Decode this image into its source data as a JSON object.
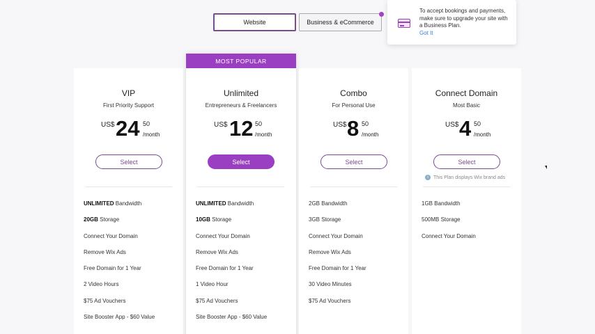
{
  "tabs": [
    {
      "label": "Website",
      "active": true
    },
    {
      "label": "Business & eCommerce",
      "active": false
    }
  ],
  "tooltip": {
    "message": "To accept bookings and payments, make sure to upgrade your site with a Business Plan.",
    "action": "Got It"
  },
  "badge": "MOST POPULAR",
  "plans": [
    {
      "name": "VIP",
      "subtitle": "First Priority Support",
      "currency": "US$",
      "price": "24",
      "cents": "50",
      "period": "/month",
      "select_label": "Select",
      "features": [
        {
          "bold": "UNLIMITED",
          "text": " Bandwidth"
        },
        {
          "bold": "20GB",
          "text": " Storage"
        },
        {
          "bold": "",
          "text": "Connect Your Domain"
        },
        {
          "bold": "",
          "text": "Remove Wix Ads"
        },
        {
          "bold": "",
          "text": "Free Domain for 1 Year"
        },
        {
          "bold": "",
          "text": "2 Video Hours"
        },
        {
          "bold": "",
          "text": "$75 Ad Vouchers"
        },
        {
          "bold": "",
          "text": "Site Booster App - $60 Value"
        }
      ]
    },
    {
      "name": "Unlimited",
      "subtitle": "Entrepreneurs & Freelancers",
      "currency": "US$",
      "price": "12",
      "cents": "50",
      "period": "/month",
      "select_label": "Select",
      "features": [
        {
          "bold": "UNLIMITED",
          "text": " Bandwidth"
        },
        {
          "bold": "10GB",
          "text": " Storage"
        },
        {
          "bold": "",
          "text": "Connect Your Domain"
        },
        {
          "bold": "",
          "text": "Remove Wix Ads"
        },
        {
          "bold": "",
          "text": "Free Domain for 1 Year"
        },
        {
          "bold": "",
          "text": "1 Video Hour"
        },
        {
          "bold": "",
          "text": "$75 Ad Vouchers"
        },
        {
          "bold": "",
          "text": "Site Booster App - $60 Value"
        }
      ]
    },
    {
      "name": "Combo",
      "subtitle": "For Personal Use",
      "currency": "US$",
      "price": "8",
      "cents": "50",
      "period": "/month",
      "select_label": "Select",
      "features": [
        {
          "bold": "",
          "text": "2GB Bandwidth"
        },
        {
          "bold": "",
          "text": "3GB Storage"
        },
        {
          "bold": "",
          "text": "Connect Your Domain"
        },
        {
          "bold": "",
          "text": "Remove Wix Ads"
        },
        {
          "bold": "",
          "text": "Free Domain for 1 Year"
        },
        {
          "bold": "",
          "text": "30 Video Minutes"
        },
        {
          "bold": "",
          "text": "$75 Ad Vouchers"
        }
      ]
    },
    {
      "name": "Connect Domain",
      "subtitle": "Most Basic",
      "currency": "US$",
      "price": "4",
      "cents": "50",
      "period": "/month",
      "select_label": "Select",
      "note": "This Plan displays Wix brand ads",
      "features": [
        {
          "bold": "",
          "text": "1GB Bandwidth"
        },
        {
          "bold": "",
          "text": "500MB Storage"
        },
        {
          "bold": "",
          "text": "Connect Your Domain"
        }
      ]
    }
  ],
  "colors": {
    "accent": "#9b3fc2",
    "outline": "#7a4b8f",
    "link": "#3a82d8"
  }
}
